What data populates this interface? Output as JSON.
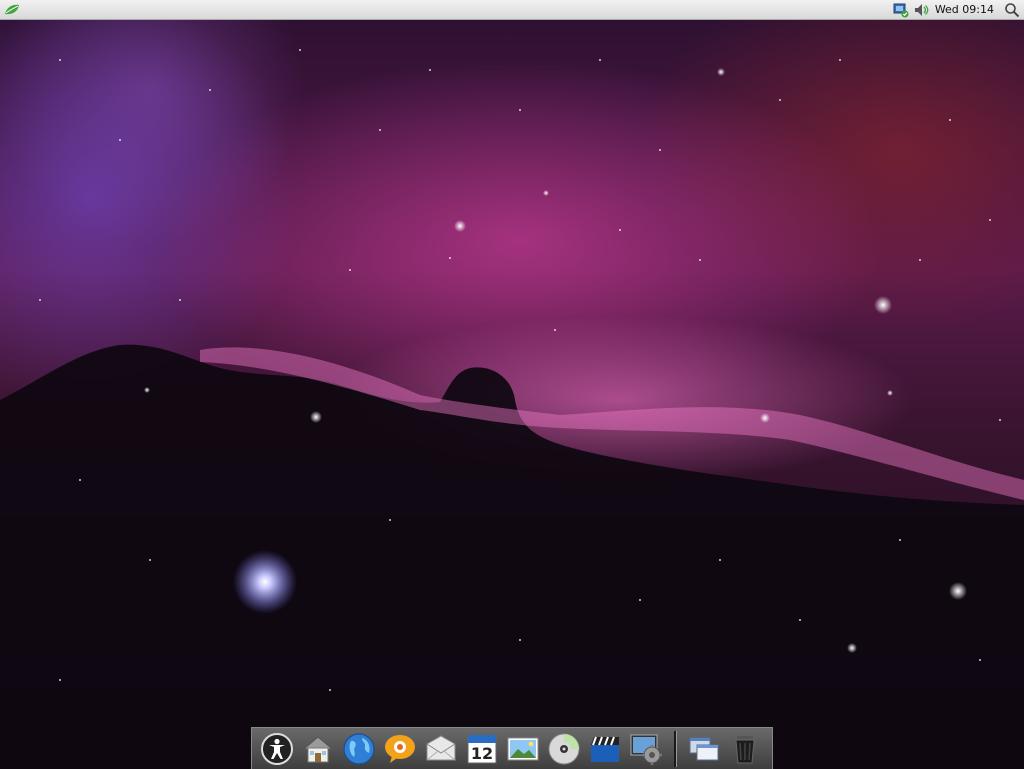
{
  "top_panel": {
    "clock": "Wed 09:14",
    "left_icon": "leaf-menu-icon",
    "tray_icons": [
      "network-icon",
      "volume-icon",
      "search-icon"
    ]
  },
  "dock": {
    "items": [
      {
        "name": "accessibility-icon"
      },
      {
        "name": "home-folder-icon"
      },
      {
        "name": "web-browser-icon"
      },
      {
        "name": "chat-icon"
      },
      {
        "name": "mail-icon"
      },
      {
        "name": "calendar-icon",
        "day": "12"
      },
      {
        "name": "photos-icon"
      },
      {
        "name": "music-cd-icon"
      },
      {
        "name": "movie-clapper-icon"
      },
      {
        "name": "system-settings-icon"
      },
      {
        "name": "windows-icon"
      },
      {
        "name": "trash-icon"
      }
    ]
  },
  "colors": {
    "panel_bg": "#e4e4e4",
    "dock_bg": "#505050",
    "nebula_pink": "#e64aa8",
    "sky_dark": "#140a14"
  }
}
